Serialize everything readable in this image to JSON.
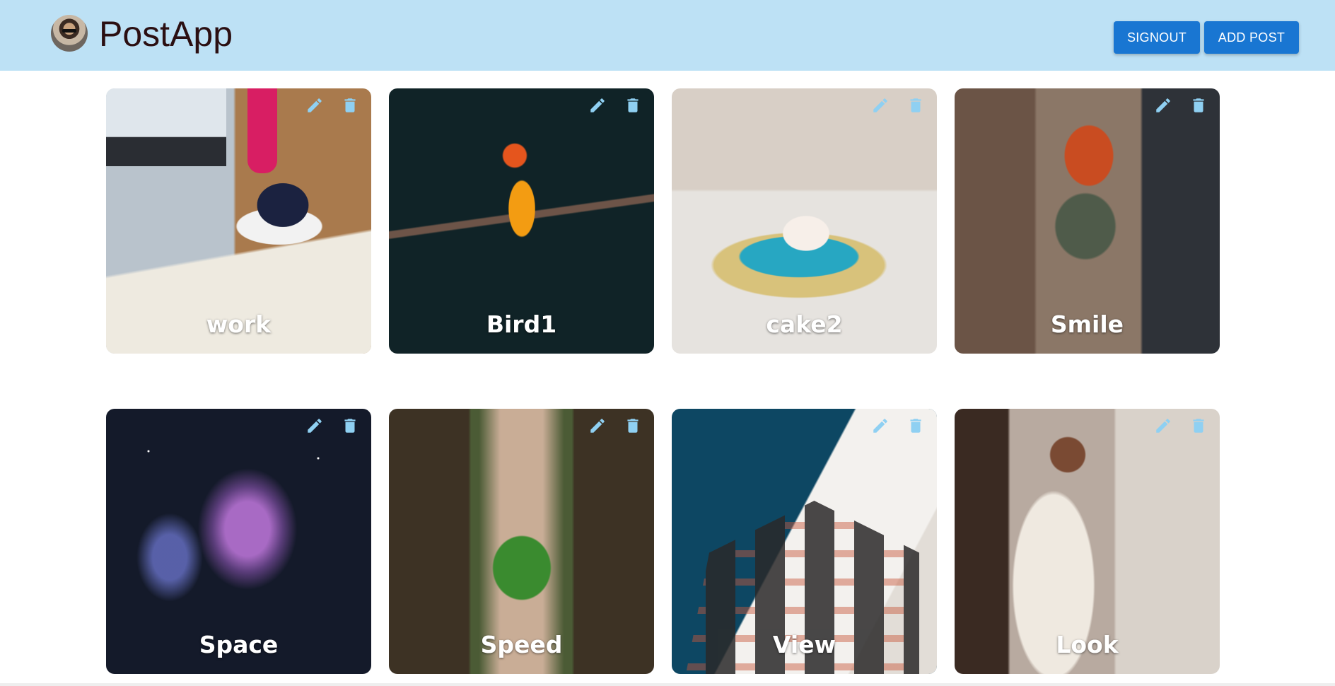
{
  "app": {
    "title": "PostApp",
    "avatar_icon": "user-avatar",
    "nav_background": "#bde1f5",
    "accent": "#1976d2"
  },
  "header": {
    "signout_label": "SIGNOUT",
    "add_post_label": "ADD POST"
  },
  "icons": {
    "edit": "pencil-icon",
    "delete": "trash-icon",
    "icon_color": "#8fd0f2"
  },
  "posts": [
    {
      "title": "work"
    },
    {
      "title": "Bird1"
    },
    {
      "title": "cake2"
    },
    {
      "title": "Smile"
    },
    {
      "title": "Space"
    },
    {
      "title": "Speed"
    },
    {
      "title": "View"
    },
    {
      "title": "Look"
    }
  ]
}
